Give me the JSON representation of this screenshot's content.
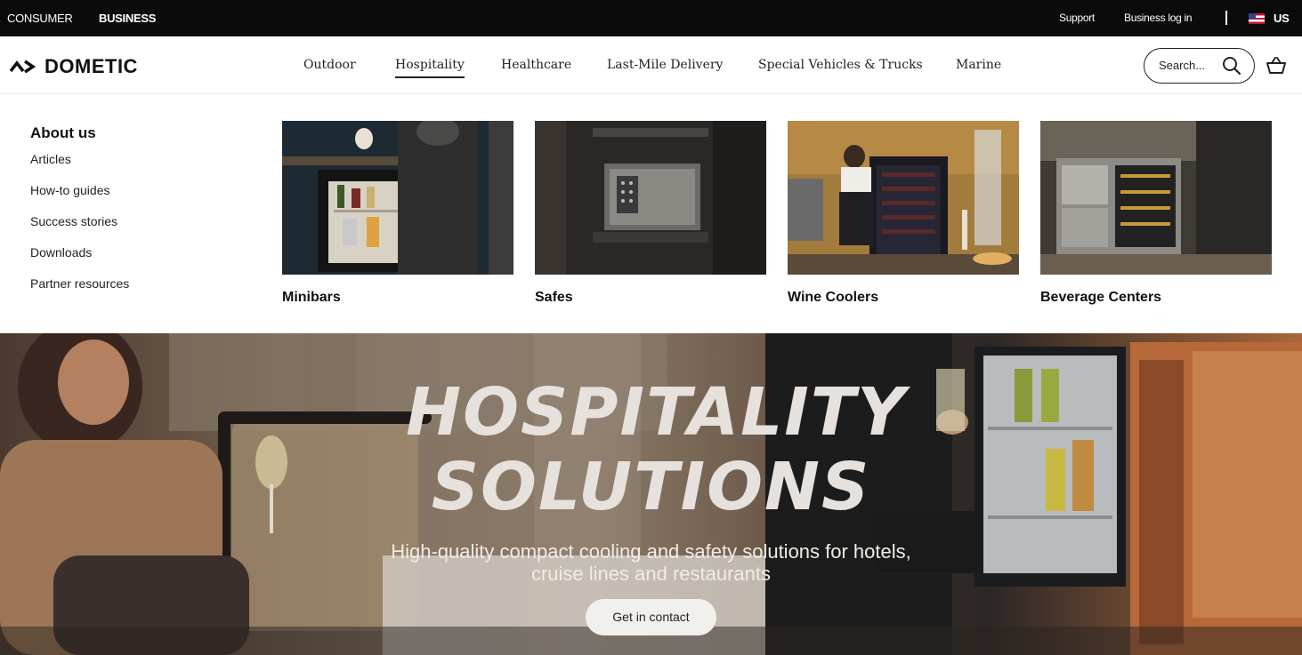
{
  "topbar": {
    "consumer": "CONSUMER",
    "business": "BUSINESS",
    "support": "Support",
    "business_login": "Business log in",
    "country": "US"
  },
  "brand": {
    "name": "DOMETIC"
  },
  "nav": {
    "items": [
      {
        "label": "Outdoor"
      },
      {
        "label": "Hospitality",
        "active": true
      },
      {
        "label": "Healthcare"
      },
      {
        "label": "Last-Mile Delivery"
      },
      {
        "label": "Special Vehicles & Trucks"
      },
      {
        "label": "Marine"
      }
    ],
    "search_placeholder": "Search..."
  },
  "mega_menu": {
    "title": "About us",
    "links": [
      "Articles",
      "How-to guides",
      "Success stories",
      "Downloads",
      "Partner resources"
    ],
    "cards": [
      {
        "label": "Minibars"
      },
      {
        "label": "Safes"
      },
      {
        "label": "Wine Coolers"
      },
      {
        "label": "Beverage Centers"
      }
    ]
  },
  "hero": {
    "title_line1": "HOSPITALITY",
    "title_line2": "SOLUTIONS",
    "subtitle_line1": "High-quality compact cooling and safety solutions for hotels,",
    "subtitle_line2": "cruise lines and restaurants",
    "cta": "Get in contact"
  },
  "colors": {
    "topbar_bg": "#0b0b0b",
    "text": "#1a1a1a",
    "hero_text": "#e6e1dc"
  }
}
